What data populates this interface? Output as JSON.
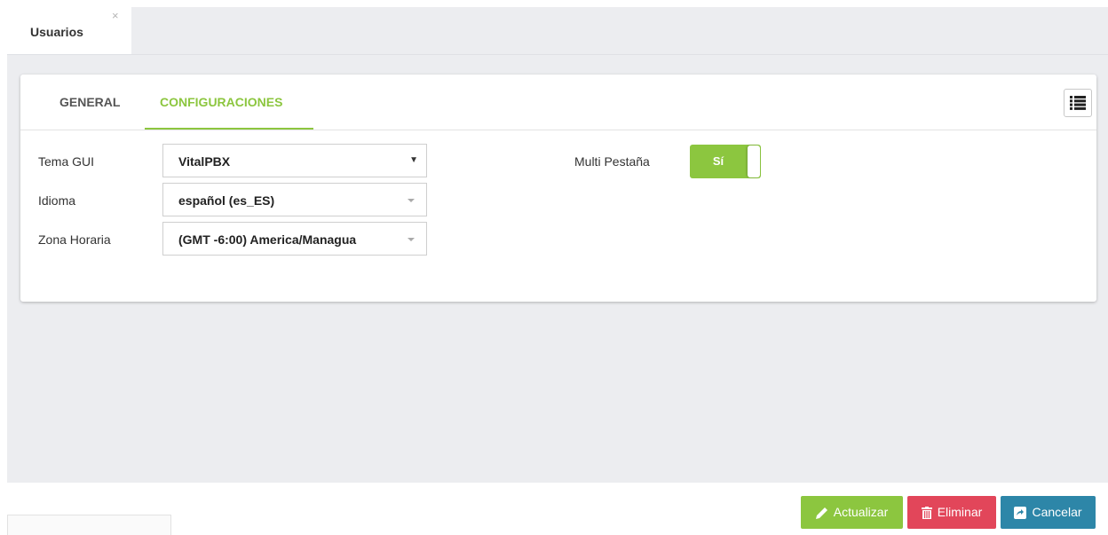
{
  "window_tabs": [
    {
      "label": "Usuarios",
      "close_glyph": "×"
    }
  ],
  "panel": {
    "tabs": [
      {
        "label": "GENERAL",
        "active": false
      },
      {
        "label": "CONFIGURACIONES",
        "active": true
      }
    ],
    "list_icon": "list-icon"
  },
  "form": {
    "theme_label": "Tema GUI",
    "theme_value": "VitalPBX",
    "language_label": "Idioma",
    "language_value": "español (es_ES)",
    "timezone_label": "Zona Horaria",
    "timezone_value": "(GMT -6:00) America/Managua",
    "multitab_label": "Multi Pestaña",
    "multitab_value": "Sí"
  },
  "actions": {
    "update_label": "Actualizar",
    "delete_label": "Eliminar",
    "cancel_label": "Cancelar"
  },
  "colors": {
    "accent": "#8cc63f",
    "danger": "#e2465a",
    "info": "#2d86a8"
  }
}
